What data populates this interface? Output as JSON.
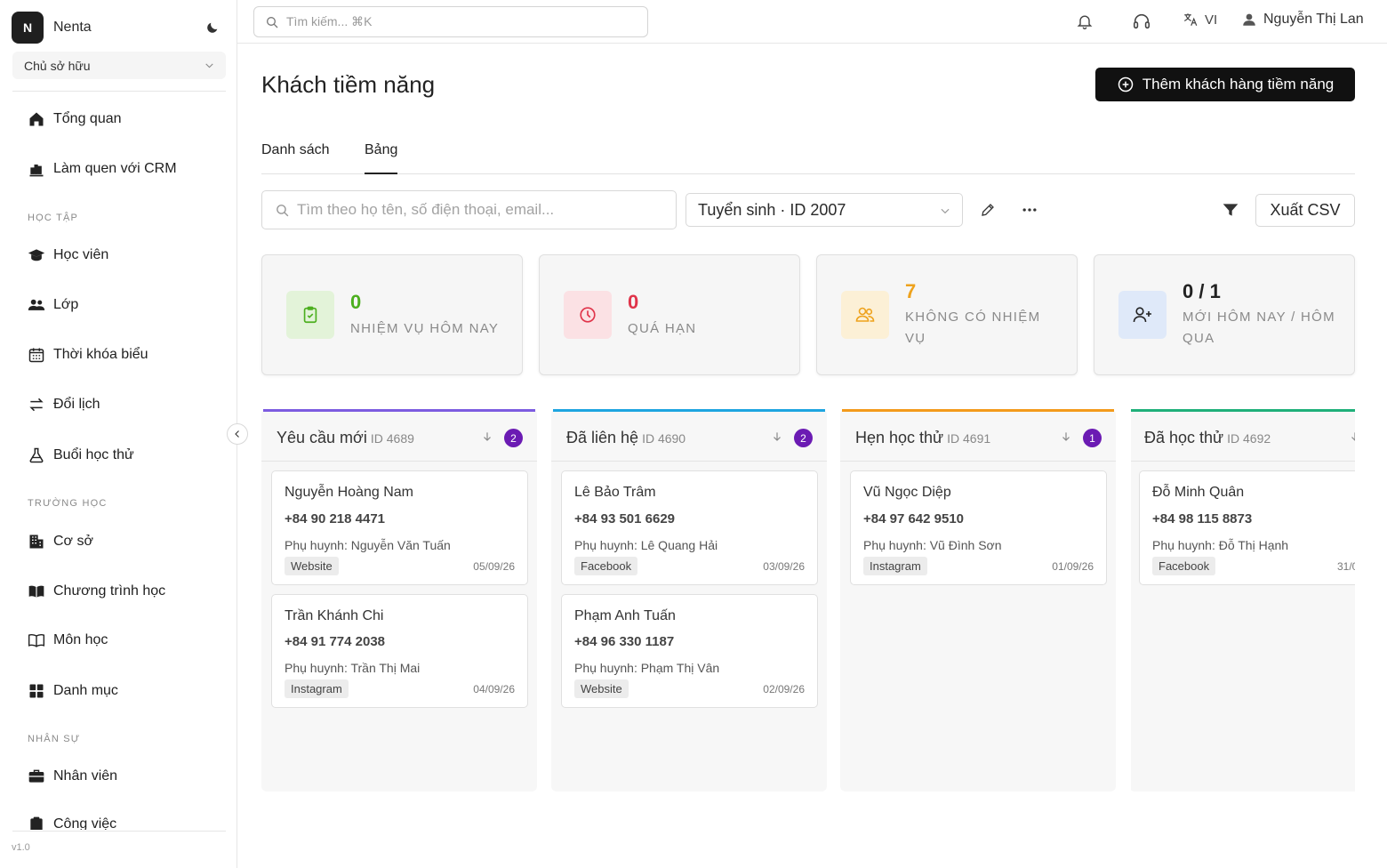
{
  "sidebar": {
    "brand": {
      "logo_letter": "N",
      "name": "Nenta"
    },
    "role": "Chủ sở hữu",
    "items": [
      {
        "label": "Tổng quan",
        "icon": "home-icon"
      },
      {
        "label": "Làm quen với CRM",
        "icon": "bar-chart-icon"
      },
      {
        "label": "Học viên",
        "icon": "graduation-cap-icon"
      },
      {
        "label": "Lớp",
        "icon": "users-icon"
      },
      {
        "label": "Thời khóa biểu",
        "icon": "calendar-icon"
      },
      {
        "label": "Đổi lịch",
        "icon": "swap-icon"
      },
      {
        "label": "Buổi học thử",
        "icon": "flask-icon"
      },
      {
        "label": "Cơ sở",
        "icon": "building-icon"
      },
      {
        "label": "Chương trình học",
        "icon": "book-open-icon"
      },
      {
        "label": "Môn học",
        "icon": "book-outline-icon"
      },
      {
        "label": "Danh mục",
        "icon": "grid-icon"
      },
      {
        "label": "Nhân viên",
        "icon": "briefcase-icon"
      },
      {
        "label": "Công việc",
        "icon": "clipboard-icon"
      }
    ],
    "sections": {
      "study": "HỌC TẬP",
      "school": "TRƯỜNG HỌC",
      "staff": "NHÂN SỰ"
    },
    "version": "v1.0"
  },
  "topbar": {
    "search_placeholder": "Tìm kiếm... ⌘K",
    "language": "VI",
    "user_name": "Nguyễn Thị Lan"
  },
  "page": {
    "title": "Khách tiềm năng",
    "add_button": "Thêm khách hàng tiềm năng",
    "tabs": [
      "Danh sách",
      "Bảng"
    ],
    "active_tab": "Bảng",
    "filter_placeholder": "Tìm theo họ tên, số điện thoại, email...",
    "pipeline": "Tuyển sinh · ID 2007",
    "export_button": "Xuất CSV"
  },
  "stats": [
    {
      "value": "0",
      "label": "NHIỆM VỤ HÔM NAY",
      "icon": "clipboard-check-icon",
      "color": "#4caf1f",
      "bg": "#e3f3d9"
    },
    {
      "value": "0",
      "label": "QUÁ HẠN",
      "icon": "clock-icon",
      "color": "#e0344a",
      "bg": "#fbe1e4"
    },
    {
      "value": "7",
      "label": "KHÔNG CÓ NHIỆM VỤ",
      "icon": "users-icon",
      "color": "#eea21c",
      "bg": "#fcf0d6"
    },
    {
      "value": "0 / 1",
      "label": "MỚI HÔM NAY / HÔM QUA",
      "icon": "user-plus-icon",
      "color": "#222222",
      "bg": "#dfe9f9"
    }
  ],
  "columns": [
    {
      "title": "Yêu cầu mới",
      "id": "ID 4689",
      "count": "2",
      "color": "#7c5ce0",
      "cards": [
        {
          "name": "Nguyễn Hoàng Nam",
          "phone": "+84 90 218 4471",
          "parent": "Phụ huynh: Nguyễn Văn Tuấn",
          "source": "Website",
          "date": "05/09/26"
        },
        {
          "name": "Trần Khánh Chi",
          "phone": "+84 91 774 2038",
          "parent": "Phụ huynh: Trần Thị Mai",
          "source": "Instagram",
          "date": "04/09/26"
        }
      ]
    },
    {
      "title": "Đã liên hệ",
      "id": "ID 4690",
      "count": "2",
      "color": "#1ea5e0",
      "cards": [
        {
          "name": "Lê Bảo Trâm",
          "phone": "+84 93 501 6629",
          "parent": "Phụ huynh: Lê Quang Hải",
          "source": "Facebook",
          "date": "03/09/26"
        },
        {
          "name": "Phạm Anh Tuấn",
          "phone": "+84 96 330 1187",
          "parent": "Phụ huynh: Phạm Thị Vân",
          "source": "Website",
          "date": "02/09/26"
        }
      ]
    },
    {
      "title": "Hẹn học thử",
      "id": "ID 4691",
      "count": "1",
      "color": "#f39a1b",
      "cards": [
        {
          "name": "Vũ Ngọc Diệp",
          "phone": "+84 97 642 9510",
          "parent": "Phụ huynh: Vũ Đình Sơn",
          "source": "Instagram",
          "date": "01/09/26"
        }
      ]
    },
    {
      "title": "Đã học thử",
      "id": "ID 4692",
      "count": "",
      "color": "#1fb07a",
      "cards": [
        {
          "name": "Đỗ Minh Quân",
          "phone": "+84 98 115 8873",
          "parent": "Phụ huynh: Đỗ Thị Hạnh",
          "source": "Facebook",
          "date": "31/0"
        }
      ]
    }
  ]
}
